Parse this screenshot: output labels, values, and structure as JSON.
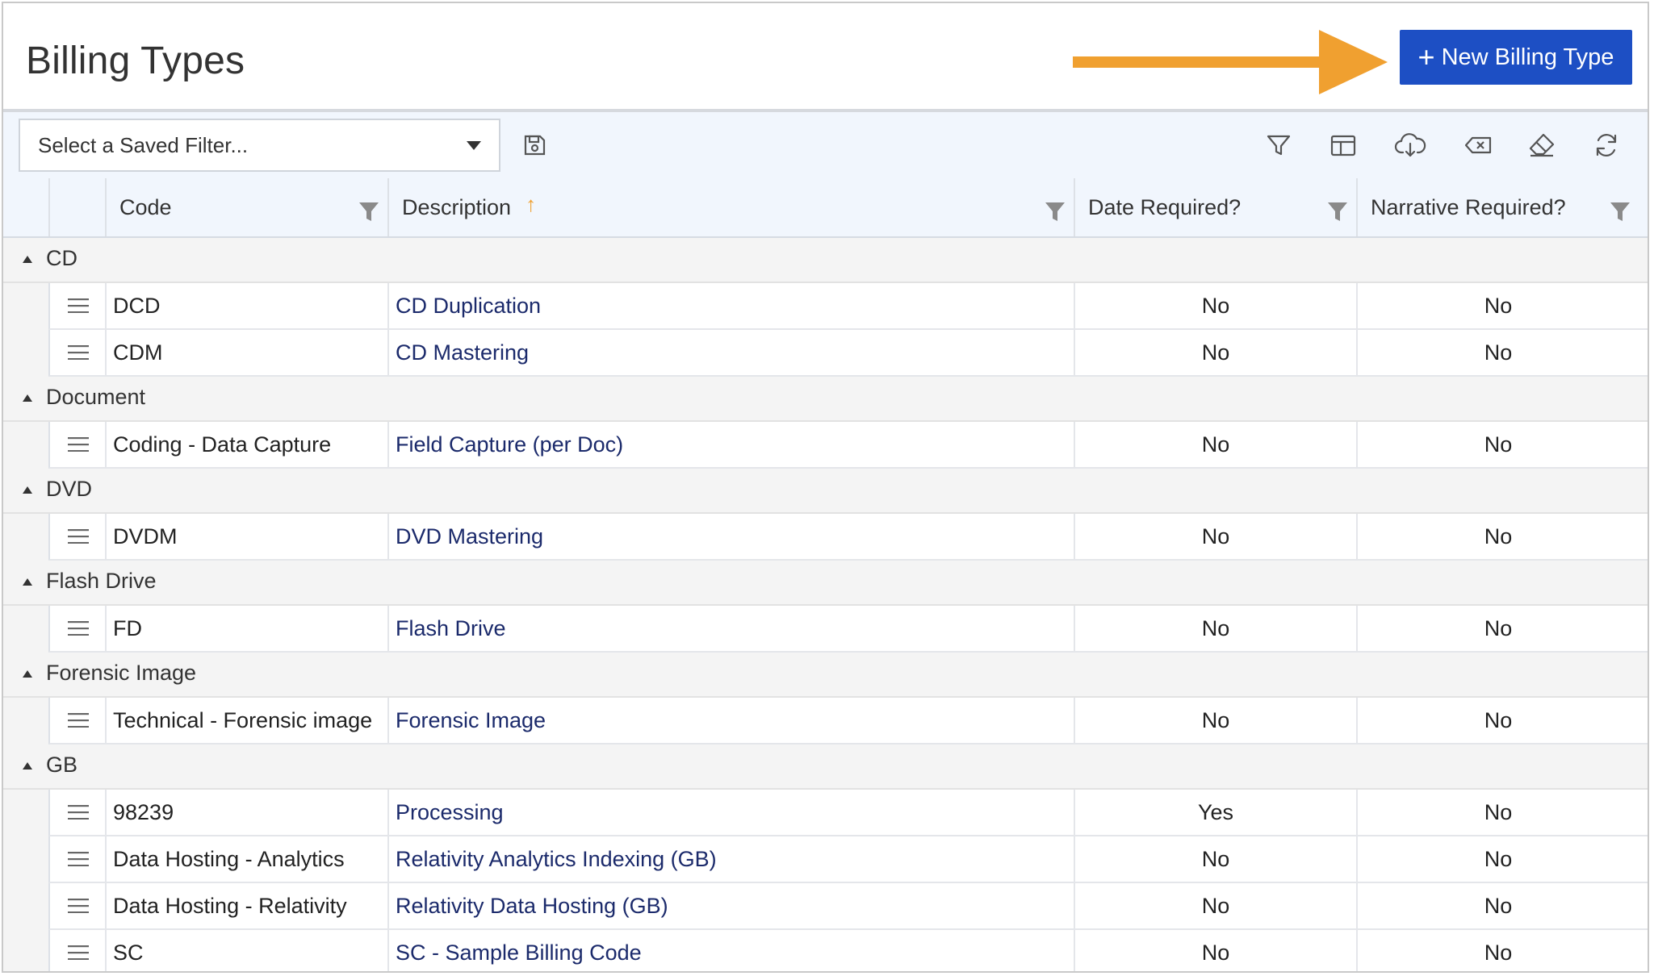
{
  "header": {
    "title": "Billing Types",
    "new_button_label": "New Billing Type",
    "new_button_icon": "plus-icon",
    "annotation_arrow_color": "#F0A030"
  },
  "toolbar": {
    "saved_filter_placeholder": "Select a Saved Filter...",
    "icons": [
      "save-icon",
      "filter-icon",
      "columns-icon",
      "cloud-download-icon",
      "clear-filter-icon",
      "eraser-icon",
      "refresh-icon"
    ]
  },
  "columns": {
    "code": "Code",
    "description": "Description",
    "date_required": "Date Required?",
    "narrative_required": "Narrative Required?"
  },
  "sort": {
    "column": "Description",
    "direction": "ascending"
  },
  "colors": {
    "accent": "#1D4FC4",
    "link": "#1B2A6B",
    "header_bg": "#F1F6FD",
    "group_bg": "#F4F4F4"
  },
  "groups": [
    {
      "name": "CD",
      "rows": [
        {
          "code": "DCD",
          "description": "CD Duplication",
          "date_required": "No",
          "narrative_required": "No"
        },
        {
          "code": "CDM",
          "description": "CD Mastering",
          "date_required": "No",
          "narrative_required": "No"
        }
      ]
    },
    {
      "name": "Document",
      "rows": [
        {
          "code": "Coding - Data Capture",
          "description": "Field Capture (per Doc)",
          "date_required": "No",
          "narrative_required": "No"
        }
      ]
    },
    {
      "name": "DVD",
      "rows": [
        {
          "code": "DVDM",
          "description": "DVD Mastering",
          "date_required": "No",
          "narrative_required": "No"
        }
      ]
    },
    {
      "name": "Flash Drive",
      "rows": [
        {
          "code": "FD",
          "description": "Flash Drive",
          "date_required": "No",
          "narrative_required": "No"
        }
      ]
    },
    {
      "name": "Forensic Image",
      "rows": [
        {
          "code": "Technical - Forensic image",
          "description": "Forensic Image",
          "date_required": "No",
          "narrative_required": "No"
        }
      ]
    },
    {
      "name": "GB",
      "rows": [
        {
          "code": "98239",
          "description": "Processing",
          "date_required": "Yes",
          "narrative_required": "No"
        },
        {
          "code": "Data Hosting - Analytics",
          "description": "Relativity Analytics Indexing (GB)",
          "date_required": "No",
          "narrative_required": "No"
        },
        {
          "code": "Data Hosting - Relativity",
          "description": "Relativity Data Hosting (GB)",
          "date_required": "No",
          "narrative_required": "No"
        },
        {
          "code": "SC",
          "description": "SC - Sample Billing Code",
          "date_required": "No",
          "narrative_required": "No"
        }
      ]
    }
  ]
}
